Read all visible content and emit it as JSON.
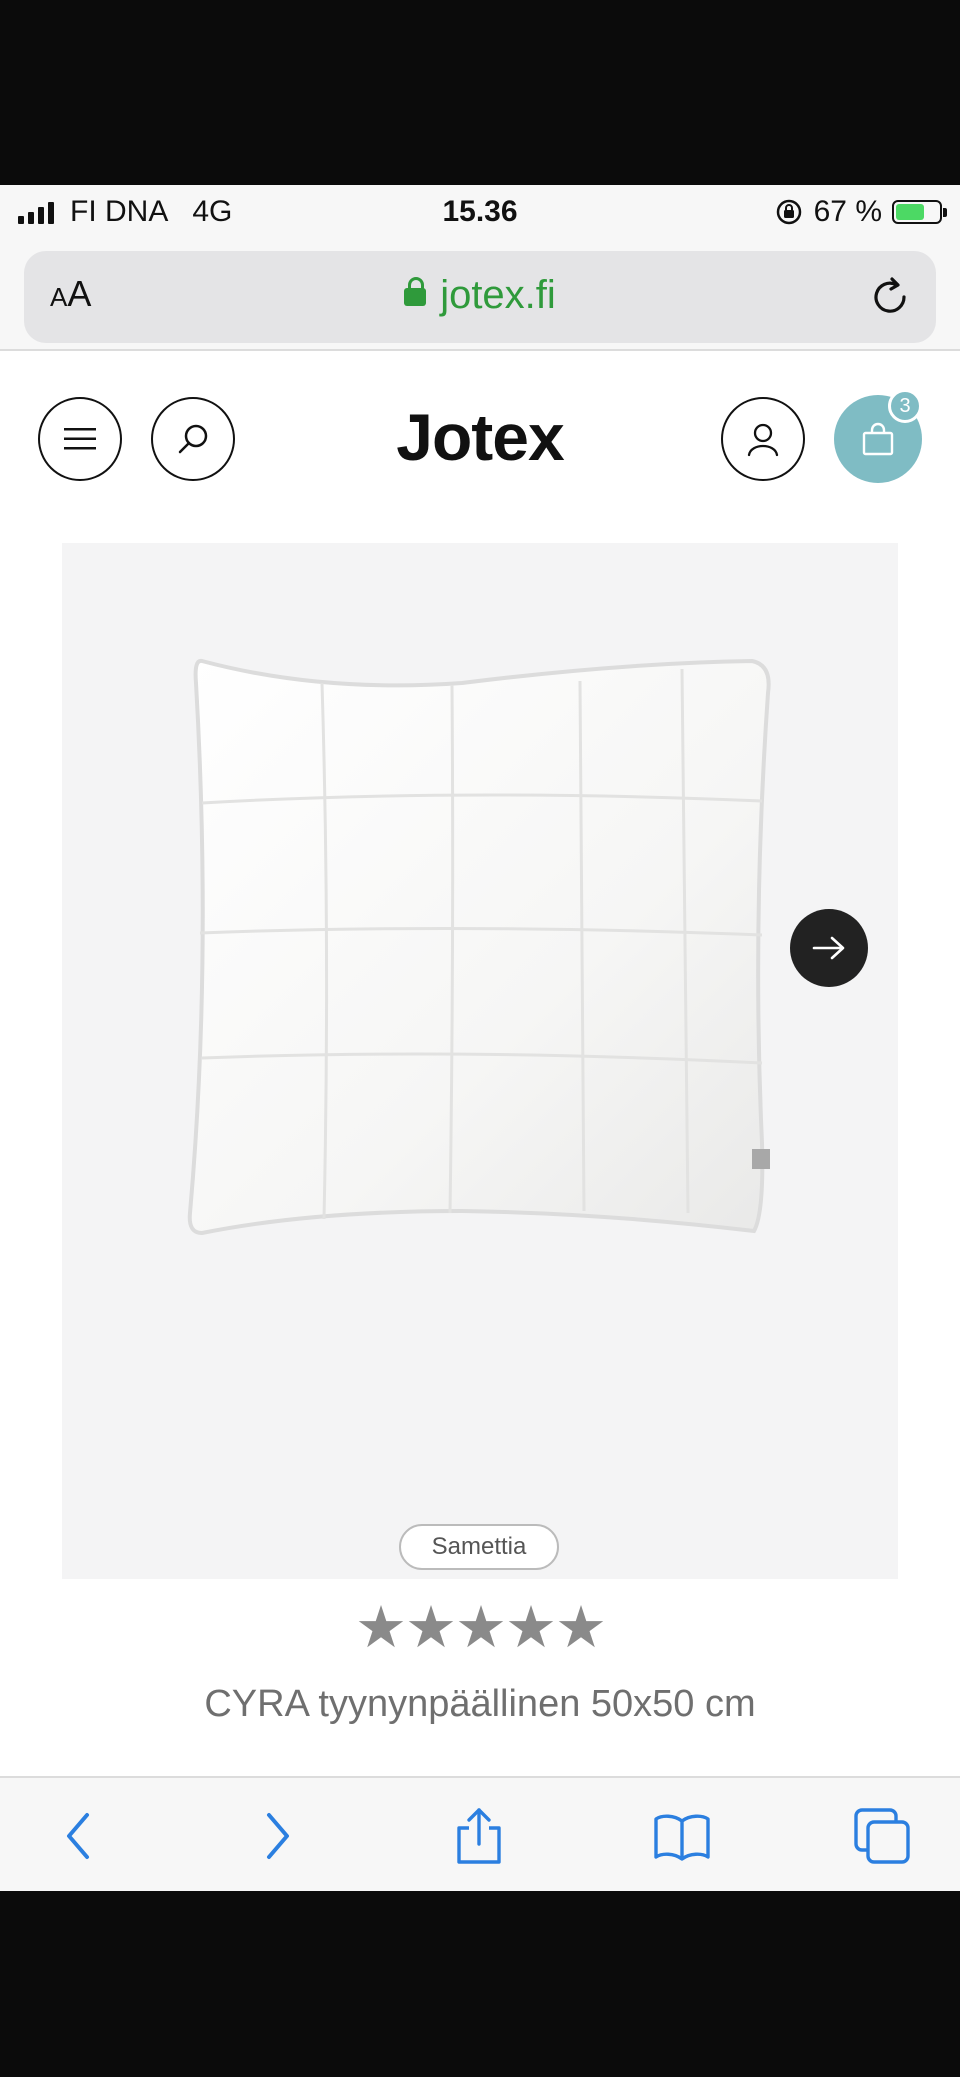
{
  "status_bar": {
    "carrier": "FI DNA",
    "network": "4G",
    "time": "15.36",
    "battery_percent": "67 %",
    "battery_level": 0.67
  },
  "address_bar": {
    "text_size_button": "AA",
    "url": "jotex.fi",
    "icons": [
      "lock-icon",
      "reload-icon"
    ]
  },
  "site_header": {
    "logo": "Jotex",
    "cart_count": "3",
    "icons": [
      "menu-icon",
      "search-icon",
      "account-icon",
      "shopping-bag-icon"
    ],
    "accent_color": "#7fbcc4"
  },
  "product": {
    "material_tag": "Samettia",
    "rating_stars": "★★★★★",
    "title": "CYRA tyynynpäällinen 50x50 cm",
    "image_icon": "next-arrow-icon"
  },
  "browser_toolbar": {
    "icons": [
      "back-icon",
      "forward-icon",
      "share-icon",
      "bookmarks-icon",
      "tabs-icon"
    ],
    "icon_color": "#2b7fe0"
  }
}
